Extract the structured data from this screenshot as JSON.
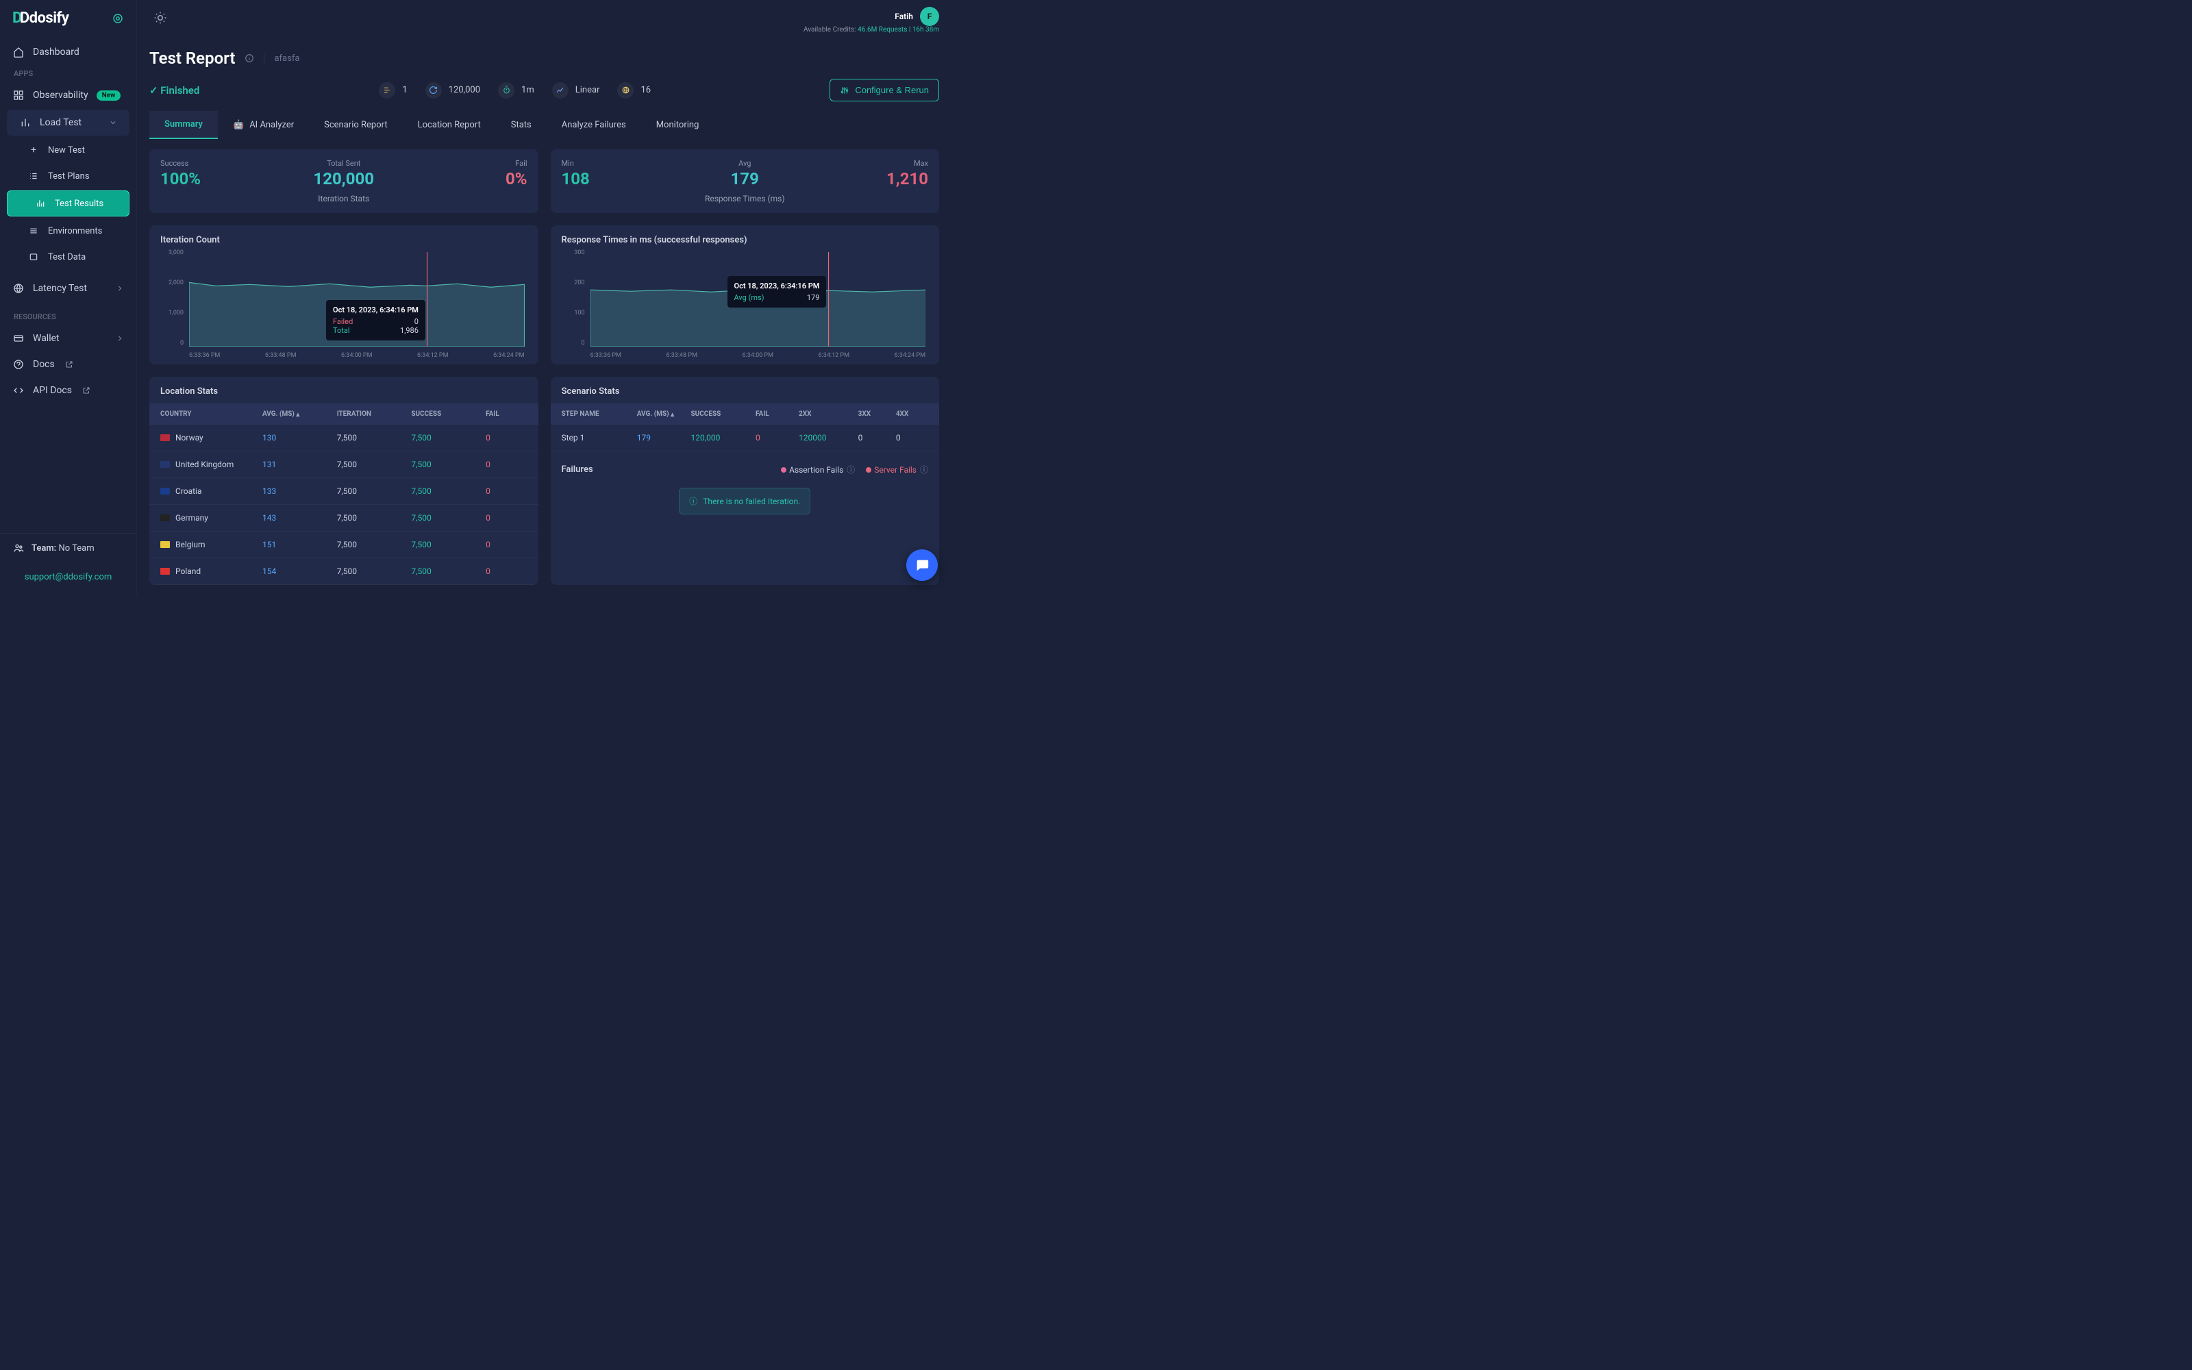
{
  "brand": "Ddosify",
  "user": {
    "name": "Fatih",
    "initial": "F"
  },
  "credits": {
    "label": "Available Credits:",
    "value": "46.6M Requests | 16h 38m"
  },
  "sidebar": {
    "dashboard": "Dashboard",
    "section_apps": "APPS",
    "observability": "Observability",
    "observability_badge": "New",
    "load_test": "Load Test",
    "new_test": "New Test",
    "test_plans": "Test Plans",
    "test_results": "Test Results",
    "environments": "Environments",
    "test_data": "Test Data",
    "latency_test": "Latency Test",
    "section_resources": "RESOURCES",
    "wallet": "Wallet",
    "docs": "Docs",
    "api_docs": "API Docs",
    "team_label": "Team:",
    "team_value": "No Team",
    "support": "support@ddosify.com"
  },
  "page": {
    "title": "Test Report",
    "breadcrumb": "afasfa",
    "status": "Finished",
    "configure_btn": "Configure & Rerun"
  },
  "run_meta": {
    "steps": "1",
    "requests": "120,000",
    "duration": "1m",
    "pattern": "Linear",
    "locations": "16"
  },
  "tabs": {
    "summary": "Summary",
    "ai": "AI Analyzer",
    "scenario": "Scenario Report",
    "location": "Location Report",
    "stats": "Stats",
    "failures": "Analyze Failures",
    "monitoring": "Monitoring"
  },
  "iteration_stats": {
    "success_label": "Success",
    "success_value": "100%",
    "total_label": "Total Sent",
    "total_value": "120,000",
    "fail_label": "Fail",
    "fail_value": "0%",
    "caption": "Iteration Stats"
  },
  "response_stats": {
    "min_label": "Min",
    "min_value": "108",
    "avg_label": "Avg",
    "avg_value": "179",
    "max_label": "Max",
    "max_value": "1,210",
    "caption": "Response Times (ms)"
  },
  "chart1": {
    "title": "Iteration Count",
    "tooltip_ts": "Oct 18, 2023, 6:34:16 PM",
    "failed_label": "Failed",
    "failed_value": "0",
    "total_label": "Total",
    "total_value": "1,986"
  },
  "chart2": {
    "title": "Response Times in ms (successful responses)",
    "tooltip_ts": "Oct 18, 2023, 6:34:16 PM",
    "avg_label": "Avg (ms)",
    "avg_value": "179"
  },
  "x_ticks": [
    "6:33:36 PM",
    "6:33:48 PM",
    "6:34:00 PM",
    "6:34:12 PM",
    "6:34:24 PM"
  ],
  "chart1_y": [
    "3,000",
    "2,000",
    "1,000",
    "0"
  ],
  "chart2_y": [
    "300",
    "200",
    "100",
    "0"
  ],
  "location_table": {
    "title": "Location Stats",
    "headers": {
      "country": "COUNTRY",
      "avg": "AVG. (MS)",
      "iter": "ITERATION",
      "succ": "SUCCESS",
      "fail": "FAIL"
    },
    "rows": [
      {
        "flag": "#ba2a3a",
        "name": "Norway",
        "avg": "130",
        "iter": "7,500",
        "succ": "7,500",
        "fail": "0"
      },
      {
        "flag": "#23366f",
        "name": "United Kingdom",
        "avg": "131",
        "iter": "7,500",
        "succ": "7,500",
        "fail": "0"
      },
      {
        "flag": "#1a3c8c",
        "name": "Croatia",
        "avg": "133",
        "iter": "7,500",
        "succ": "7,500",
        "fail": "0"
      },
      {
        "flag": "#222",
        "name": "Germany",
        "avg": "143",
        "iter": "7,500",
        "succ": "7,500",
        "fail": "0"
      },
      {
        "flag": "#e8c63b",
        "name": "Belgium",
        "avg": "151",
        "iter": "7,500",
        "succ": "7,500",
        "fail": "0"
      },
      {
        "flag": "#d33",
        "name": "Poland",
        "avg": "154",
        "iter": "7,500",
        "succ": "7,500",
        "fail": "0"
      }
    ]
  },
  "scenario_table": {
    "title": "Scenario Stats",
    "headers": {
      "step": "STEP NAME",
      "avg": "AVG. (MS)",
      "succ": "SUCCESS",
      "fail": "FAIL",
      "c2": "2XX",
      "c3": "3XX",
      "c4": "4XX"
    },
    "rows": [
      {
        "step": "Step 1",
        "avg": "179",
        "succ": "120,000",
        "fail": "0",
        "c2": "120000",
        "c3": "0",
        "c4": "0"
      }
    ]
  },
  "failures": {
    "title": "Failures",
    "assert": "Assertion Fails",
    "server": "Server Fails",
    "empty": "There is no failed Iteration."
  },
  "chart_data": [
    {
      "type": "area",
      "title": "Iteration Count",
      "x": [
        "6:33:36 PM",
        "6:33:48 PM",
        "6:34:00 PM",
        "6:34:12 PM",
        "6:34:24 PM"
      ],
      "series": [
        {
          "name": "Total",
          "values": [
            2050,
            1990,
            1980,
            2000,
            1986,
            1995,
            1980
          ]
        },
        {
          "name": "Failed",
          "values": [
            0,
            0,
            0,
            0,
            0,
            0,
            0
          ]
        }
      ],
      "ylim": [
        0,
        3000
      ],
      "marker": {
        "timestamp": "Oct 18, 2023, 6:34:16 PM",
        "Total": 1986,
        "Failed": 0
      }
    },
    {
      "type": "area",
      "title": "Response Times in ms (successful responses)",
      "x": [
        "6:33:36 PM",
        "6:33:48 PM",
        "6:34:00 PM",
        "6:34:12 PM",
        "6:34:24 PM"
      ],
      "series": [
        {
          "name": "Avg (ms)",
          "values": [
            180,
            178,
            179,
            180,
            179,
            181,
            179
          ]
        }
      ],
      "ylim": [
        0,
        300
      ],
      "marker": {
        "timestamp": "Oct 18, 2023, 6:34:16 PM",
        "Avg (ms)": 179
      }
    }
  ]
}
